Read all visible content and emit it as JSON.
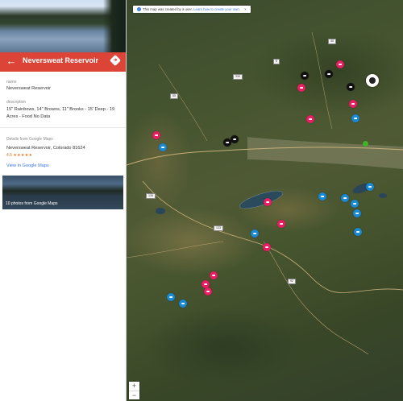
{
  "panel": {
    "title": "Neversweat Reservoir",
    "name_label": "name",
    "name_value": "Neversweat Reservoir",
    "description_label": "description",
    "description_value": "15\" Rainbows, 14\" Browns, 11\" Brooks - 15' Deep - 19 Acres - Food No Data",
    "details_label": "Details from Google Maps",
    "address": "Neversweat Reservoir, Colorado 81624",
    "rating_value": "4.6",
    "rating_stars": "★★★★★",
    "view_link": "View in Google Maps",
    "photos_caption": "10 photos from Google Maps"
  },
  "map": {
    "notice_text": "This map was created by a user.",
    "notice_link": "Learn how to create your own.",
    "zoom_in": "+",
    "zoom_out": "−",
    "route_shields": [
      "6",
      "65",
      "135",
      "330",
      "133",
      "92",
      "40"
    ]
  },
  "colors": {
    "accent": "#db4437",
    "marker_pink": "#e91e63",
    "marker_blue": "#1a8ad4",
    "marker_black": "#111111",
    "link": "#3b78e7"
  }
}
